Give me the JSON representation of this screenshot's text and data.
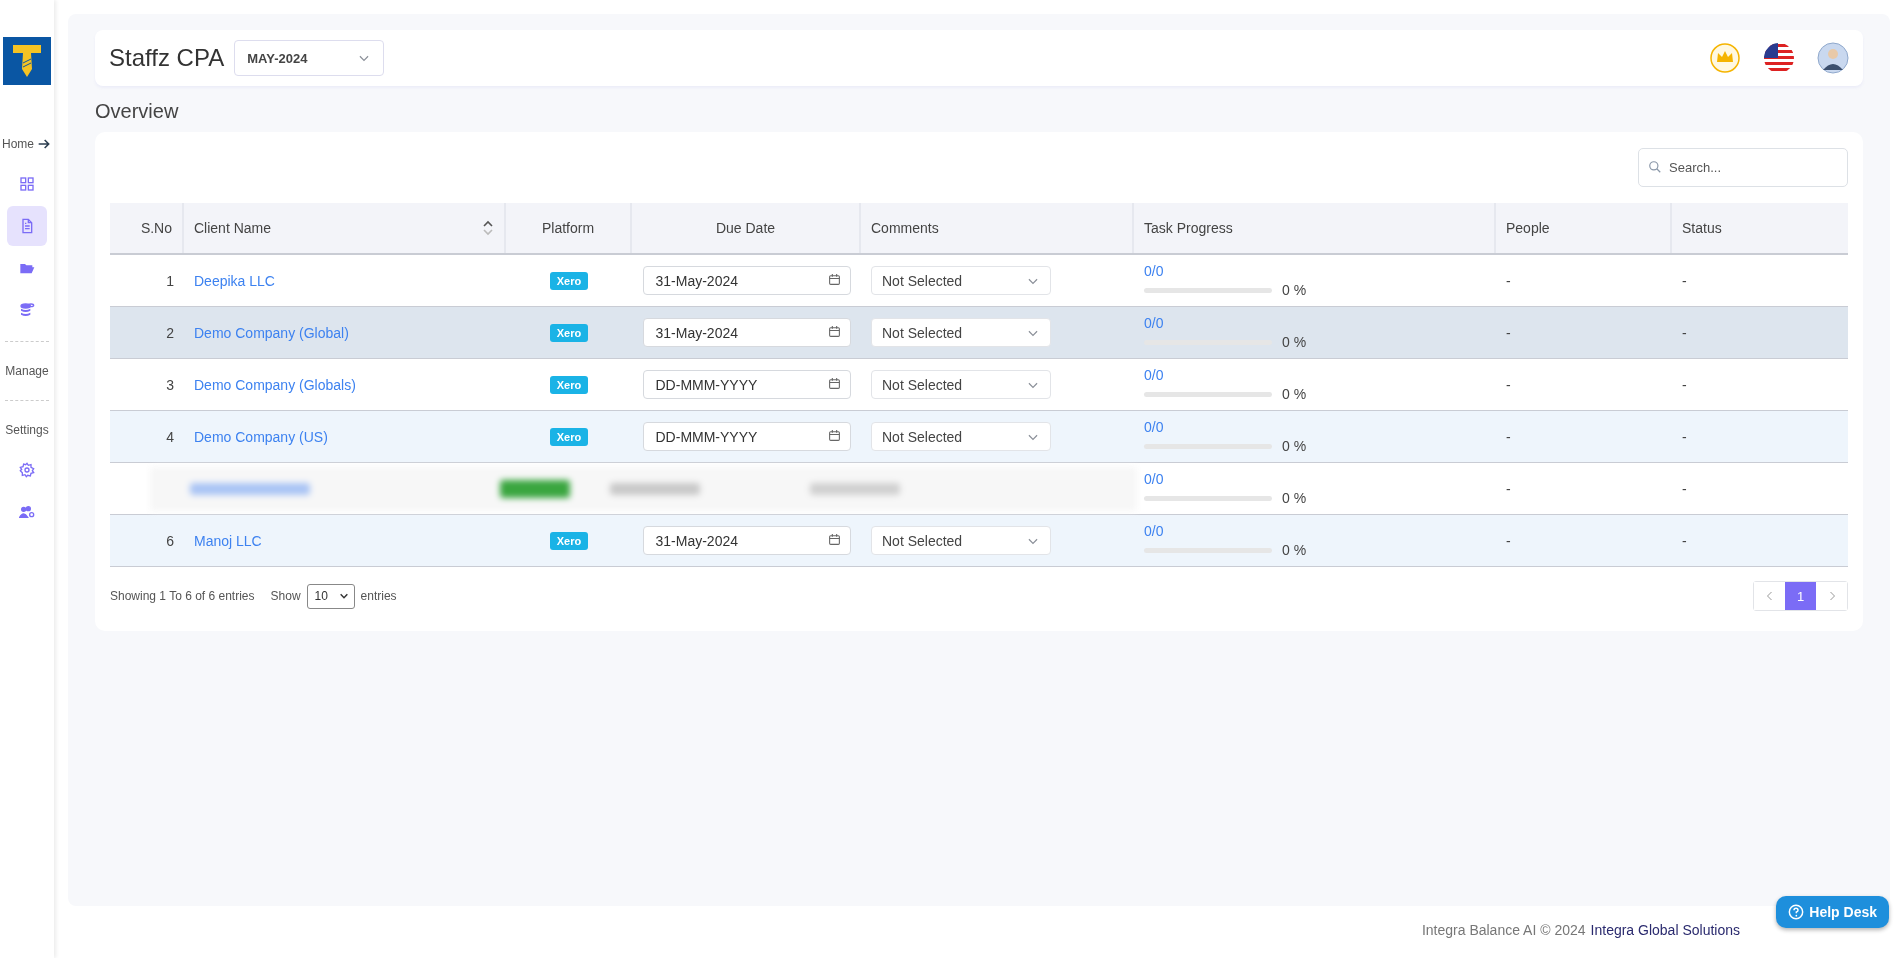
{
  "sidebar": {
    "items": [
      {
        "kind": "heading",
        "label": "Home"
      },
      {
        "kind": "grid",
        "selected": false
      },
      {
        "kind": "document",
        "selected": true
      },
      {
        "kind": "folder",
        "selected": false
      },
      {
        "kind": "database",
        "selected": false
      },
      {
        "kind": "divider"
      },
      {
        "kind": "heading",
        "label": "Manage"
      },
      {
        "kind": "divider"
      },
      {
        "kind": "heading",
        "label": "Settings"
      },
      {
        "kind": "gear",
        "selected": false
      },
      {
        "kind": "users",
        "selected": false
      }
    ]
  },
  "header": {
    "title": "Staffz CPA",
    "period": "MAY-2024"
  },
  "page_title": "Overview",
  "search": {
    "placeholder": "Search..."
  },
  "table": {
    "columns": [
      {
        "label": "S.No",
        "sortable": false
      },
      {
        "label": "Client Name",
        "sortable": true
      },
      {
        "label": "Platform",
        "sortable": false
      },
      {
        "label": "Due Date",
        "sortable": false
      },
      {
        "label": "Comments",
        "sortable": false
      },
      {
        "label": "Task Progress",
        "sortable": false
      },
      {
        "label": "People",
        "sortable": false
      },
      {
        "label": "Status",
        "sortable": false
      }
    ],
    "rows": [
      {
        "kind": "client",
        "s_no": "1",
        "client": "Deepika LLC",
        "platform": "Xero",
        "due_date": {
          "value": "31-May-2024"
        },
        "comments": "Not Selected",
        "progress": "0/0",
        "level": 0,
        "percent": "0 %",
        "people": "-",
        "status": "-",
        "selected": false
      },
      {
        "kind": "client",
        "s_no": "2",
        "client": "Demo Company (Global)",
        "platform": "Xero",
        "due_date": {
          "value": "31-May-2024"
        },
        "comments": "Not Selected",
        "progress": "0/0",
        "level": 0,
        "percent": "0 %",
        "people": "-",
        "status": "-",
        "selected": true
      },
      {
        "kind": "client",
        "s_no": "3",
        "client": "Demo Company (Globals)",
        "platform": "Xero",
        "due_date": {
          "placeholder": "DD-MMM-YYYY"
        },
        "comments": "Not Selected",
        "progress": "0/0",
        "level": 0,
        "percent": "0 %",
        "people": "-",
        "status": "-",
        "selected": false
      },
      {
        "kind": "client",
        "s_no": "4",
        "client": "Demo Company (US)",
        "platform": "Xero",
        "due_date": {
          "placeholder": "DD-MMM-YYYY"
        },
        "comments": "Not Selected",
        "progress": "0/0",
        "level": 0,
        "percent": "0 %",
        "people": "-",
        "status": "-",
        "selected": false
      },
      {
        "kind": "redacted",
        "progress": "0/0",
        "level": 0,
        "percent": "0 %",
        "people": "-",
        "status": "-",
        "selected": false
      },
      {
        "kind": "client",
        "s_no": "6",
        "client": "Manoj LLC",
        "platform": "Xero",
        "due_date": {
          "value": "31-May-2024"
        },
        "comments": "Not Selected",
        "progress": "0/0",
        "level": 0,
        "percent": "0 %",
        "people": "-",
        "status": "-",
        "selected": false
      }
    ]
  },
  "table_footer": {
    "summary": "Showing 1 To 6 of 6 entries",
    "show_label": "Show",
    "page_size": "10",
    "entries_label": "entries",
    "pages": [
      {
        "label": "1",
        "selected": true
      }
    ]
  },
  "footer": {
    "copyright": "Integra Balance AI © 2024",
    "company_link": "Integra Global Solutions"
  },
  "help_button": "Help Desk"
}
